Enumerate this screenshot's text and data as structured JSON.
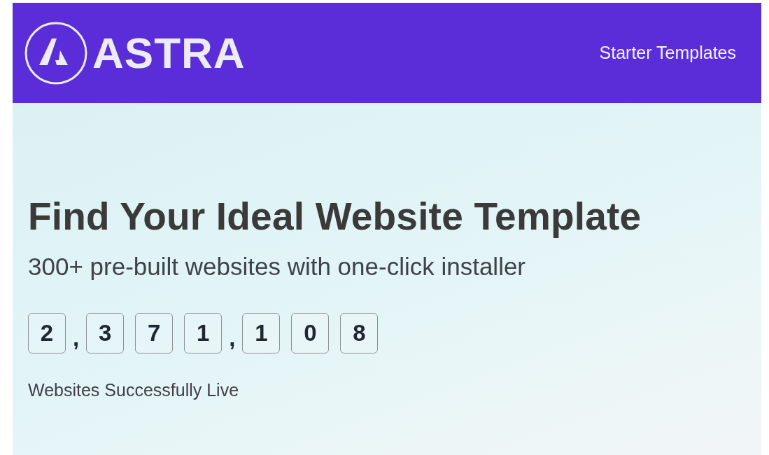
{
  "header": {
    "logo_text": "ASTRA",
    "nav_link": "Starter Templates"
  },
  "hero": {
    "title": "Find Your Ideal Website Template",
    "subtitle": "300+ pre-built websites with one-click installer",
    "counter": [
      {
        "kind": "digit",
        "text": "2"
      },
      {
        "kind": "separator",
        "text": ","
      },
      {
        "kind": "digit",
        "text": "3"
      },
      {
        "kind": "digit",
        "text": "7"
      },
      {
        "kind": "digit",
        "text": "1"
      },
      {
        "kind": "separator",
        "text": ","
      },
      {
        "kind": "digit",
        "text": "1"
      },
      {
        "kind": "digit",
        "text": "0"
      },
      {
        "kind": "digit",
        "text": "8"
      }
    ],
    "counter_label": "Websites Successfully Live"
  }
}
